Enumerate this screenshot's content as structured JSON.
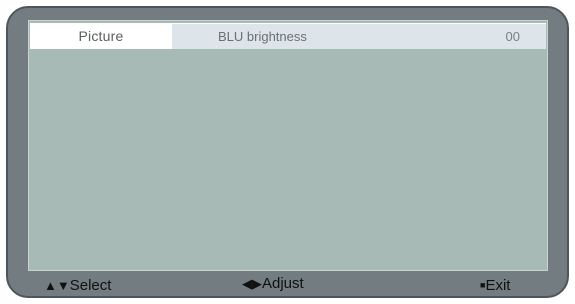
{
  "menu": {
    "tab_label": "Picture",
    "item_label": "BLU brightness",
    "item_value": "00"
  },
  "footer": {
    "select_glyph": "▲▼",
    "select_label": "Select",
    "adjust_glyph": "◀▶",
    "adjust_label": "Adjust",
    "exit_glyph": "■",
    "exit_label": "Exit"
  },
  "colors": {
    "bezel": "#727c81",
    "screen_background": "#a8bab5",
    "tab_background": "#ffffff",
    "item_background": "#dde5ea"
  }
}
